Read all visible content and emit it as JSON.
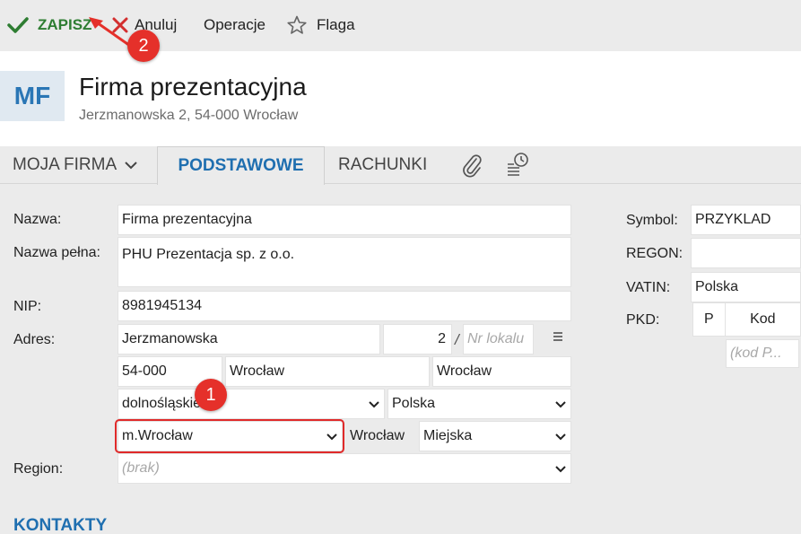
{
  "toolbar": {
    "save_label": "ZAPISZ",
    "cancel_label": "Anuluj",
    "operations_label": "Operacje",
    "flag_label": "Flaga"
  },
  "header": {
    "avatar_initials": "MF",
    "company_name": "Firma prezentacyjna",
    "company_address": "Jerzmanowska 2, 54-000 Wrocław"
  },
  "tabs": {
    "moja_firma": "MOJA FIRMA",
    "podstawowe": "PODSTAWOWE",
    "rachunki": "RACHUNKI",
    "attachment_icon": "paperclip-icon",
    "history_icon": "history-icon"
  },
  "form": {
    "nazwa_label": "Nazwa:",
    "nazwa_value": "Firma prezentacyjna",
    "nazwa_pelna_label": "Nazwa pełna:",
    "nazwa_pelna_value": "PHU Prezentacja sp. z o.o.",
    "nip_label": "NIP:",
    "nip_value": "8981945134",
    "adres_label": "Adres:",
    "street_value": "Jerzmanowska",
    "building_value": "2",
    "slash": "/",
    "apartment_placeholder": "Nr lokalu",
    "postal_code_value": "54-000",
    "city_value": "Wrocław",
    "post_office_value": "Wrocław",
    "voivodeship_value": "dolnośląskie",
    "country_value": "Polska",
    "county_value": "m.Wrocław",
    "commune_value": "Wrocław",
    "commune_type_value": "Miejska",
    "region_label": "Region:",
    "region_placeholder": "(brak)"
  },
  "right_panel": {
    "symbol_label": "Symbol:",
    "symbol_value": "PRZYKLAD",
    "regon_label": "REGON:",
    "regon_value": "",
    "vatin_label": "VATIN:",
    "vatin_value": "Polska",
    "pkd_label": "PKD:",
    "pkd_col_p": "P",
    "pkd_col_kod": "Kod",
    "pkd_placeholder": "(kod P..."
  },
  "annotations": {
    "badge_1": "1",
    "badge_2": "2",
    "accent_color": "#e5302a"
  },
  "sections": {
    "kontakty": "KONTAKTY"
  },
  "colors": {
    "save_green": "#2e7d32",
    "link_blue": "#1f6fb0",
    "cancel_red": "#d32f2f"
  }
}
